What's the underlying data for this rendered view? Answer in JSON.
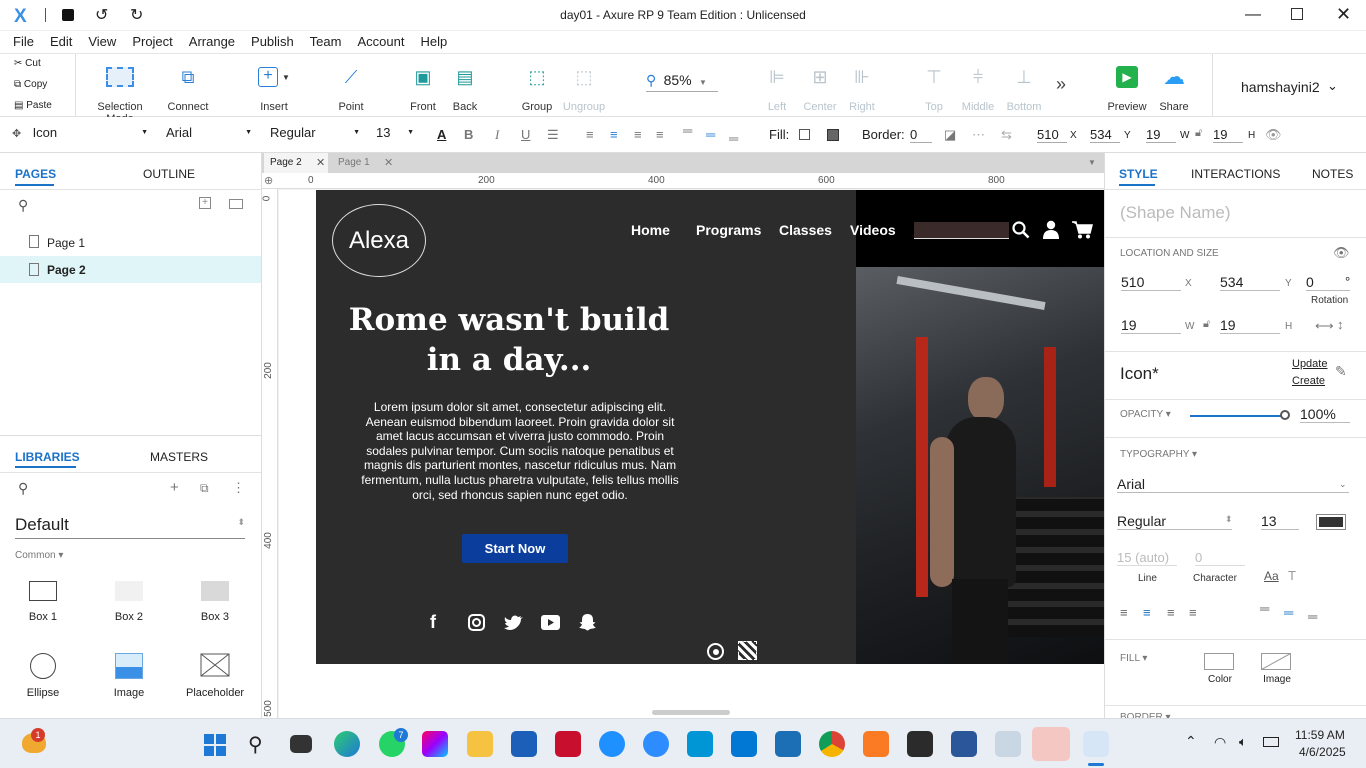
{
  "window": {
    "title": "day01 - Axure RP 9 Team Edition : Unlicensed"
  },
  "menu": [
    "File",
    "Edit",
    "View",
    "Project",
    "Arrange",
    "Publish",
    "Team",
    "Account",
    "Help"
  ],
  "clipboard": {
    "cut": "Cut",
    "copy": "Copy",
    "paste": "Paste"
  },
  "toolbar": {
    "selection_mode": "Selection Mode",
    "connect": "Connect",
    "insert": "Insert",
    "point": "Point",
    "front": "Front",
    "back": "Back",
    "group": "Group",
    "ungroup": "Ungroup",
    "zoom": "85%",
    "left": "Left",
    "center": "Center",
    "right": "Right",
    "top": "Top",
    "middle": "Middle",
    "bottom": "Bottom",
    "preview": "Preview",
    "share": "Share",
    "user": "hamshayini2"
  },
  "propbar": {
    "widget_type": "Icon",
    "font": "Arial",
    "weight": "Regular",
    "size": "13",
    "fill_label": "Fill:",
    "border_label": "Border:",
    "border_value": "0",
    "x": "510",
    "x_lbl": "X",
    "y": "534",
    "y_lbl": "Y",
    "w": "19",
    "w_lbl": "W",
    "h": "19",
    "h_lbl": "H"
  },
  "left": {
    "tab_pages": "PAGES",
    "tab_outline": "OUTLINE",
    "pages": [
      "Page 1",
      "Page 2"
    ],
    "tab_libraries": "LIBRARIES",
    "tab_masters": "MASTERS",
    "library": "Default",
    "group": "Common ▾",
    "widgets": [
      "Box 1",
      "Box 2",
      "Box 3",
      "Ellipse",
      "Image",
      "Placeholder"
    ]
  },
  "doc_tabs": [
    "Page 2",
    "Page 1"
  ],
  "ruler": {
    "h": [
      "0",
      "200",
      "400",
      "600",
      "800"
    ],
    "v": [
      "0",
      "200",
      "400",
      "500"
    ]
  },
  "design": {
    "logo": "Alexa",
    "nav": [
      "Home",
      "Programs",
      "Classes",
      "Videos"
    ],
    "headline1": "Rome wasn't build",
    "headline2": "in a day...",
    "body": "Lorem ipsum dolor sit amet, consectetur adipiscing elit. Aenean euismod bibendum laoreet. Proin gravida dolor sit amet lacus accumsan et viverra justo commodo. Proin sodales pulvinar tempor. Cum sociis natoque penatibus et magnis dis parturient montes, nascetur ridiculus mus. Nam fermentum, nulla luctus pharetra vulputate, felis tellus mollis orci, sed rhoncus sapien nunc eget odio.",
    "cta": "Start Now",
    "social": [
      "facebook-icon",
      "instagram-icon",
      "twitter-icon",
      "youtube-icon",
      "snapchat-icon"
    ]
  },
  "right": {
    "tab_style": "STYLE",
    "tab_interactions": "INTERACTIONS",
    "tab_notes": "NOTES",
    "shape_name_placeholder": "(Shape Name)",
    "loc_title": "LOCATION AND SIZE",
    "x": "510",
    "x_lbl": "X",
    "y": "534",
    "y_lbl": "Y",
    "rotation": "0",
    "deg": "°",
    "rotation_lbl": "Rotation",
    "w": "19",
    "w_lbl": "W",
    "h": "19",
    "h_lbl": "H",
    "style_name": "Icon*",
    "update": "Update",
    "create": "Create",
    "opacity_lbl": "OPACITY ▾",
    "opacity": "100%",
    "typo_lbl": "TYPOGRAPHY ▾",
    "font": "Arial",
    "weight": "Regular",
    "size": "13",
    "line": "15 (auto)",
    "char": "0",
    "line_lbl": "Line",
    "char_lbl": "Character",
    "fill_lbl": "FILL ▾",
    "fill_color": "Color",
    "fill_image": "Image",
    "border_lbl": "BORDER ▾",
    "text_color": "#333333"
  },
  "taskbar": {
    "time": "11:59 AM",
    "date": "4/6/2025",
    "badge_whatsapp": "7",
    "badge_weather": "1"
  },
  "colors": {
    "accent": "#1a73c8",
    "cta": "#0a3d9c",
    "preview": "#22b14c",
    "design_bg": "#2c2c2c"
  }
}
